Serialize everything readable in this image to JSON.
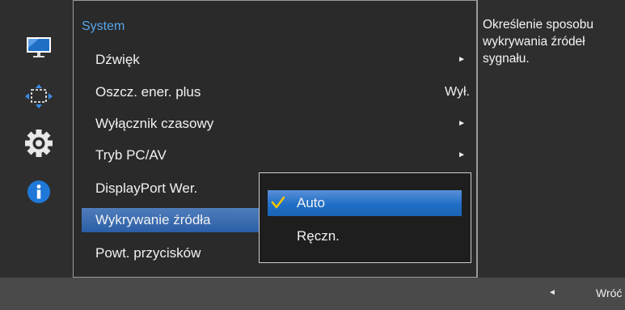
{
  "menu": {
    "title": "System",
    "items": [
      {
        "label": "Dźwięk",
        "value": "",
        "arrow": "►"
      },
      {
        "label": "Oszcz. ener. plus",
        "value": "Wył.",
        "arrow": ""
      },
      {
        "label": "Wyłącznik czasowy",
        "value": "",
        "arrow": "►"
      },
      {
        "label": "Tryb PC/AV",
        "value": "",
        "arrow": "►"
      },
      {
        "label": "DisplayPort Wer.",
        "value": "",
        "arrow": ""
      },
      {
        "label": "Wykrywanie źródła",
        "value": "",
        "arrow": ""
      },
      {
        "label": "Powt. przycisków",
        "value": "",
        "arrow": ""
      }
    ]
  },
  "submenu": {
    "options": [
      {
        "label": "Auto",
        "checked": true
      },
      {
        "label": "Ręczn.",
        "checked": false
      }
    ]
  },
  "description": "Określenie sposobu wykrywania źródeł sygnału.",
  "footer": {
    "back_arrow": "◄",
    "back_label": "Wróć"
  },
  "icons": [
    "picture-icon",
    "position-icon",
    "settings-gear-icon",
    "info-icon"
  ],
  "colors": {
    "accent": "#56a6ea",
    "selected": "#2b5ea6",
    "checkmark": "#f2c200"
  }
}
